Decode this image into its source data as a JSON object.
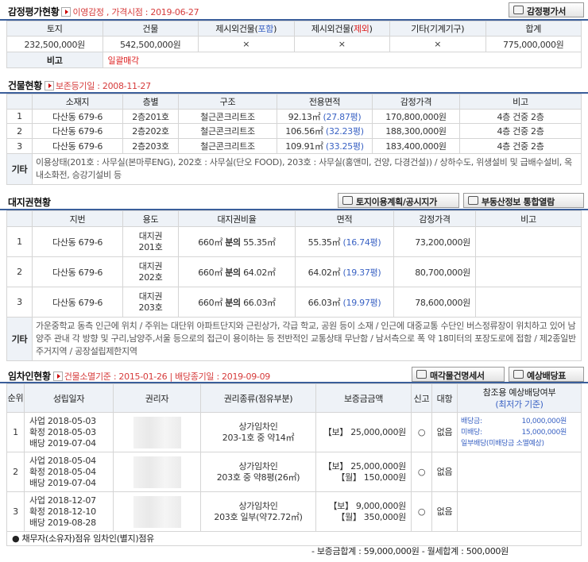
{
  "appraisal": {
    "title": "감정평가현황",
    "sub": "이영감정 , 가격시점 : 2019-06-27",
    "button": "감정평가서",
    "headers": [
      "토지",
      "건물",
      "제시외건물(포함)",
      "제시외건물(제외)",
      "기타(기계기구)",
      "합계"
    ],
    "h3a": "제시외건물(",
    "h3b": "포함",
    "h3c": ")",
    "h4a": "제시외건물(",
    "h4b": "제외",
    "h4c": ")",
    "values": [
      "232,500,000원",
      "542,500,000원",
      "×",
      "×",
      "×",
      "775,000,000원"
    ],
    "note_label": "비고",
    "note_value": "일괄매각"
  },
  "building": {
    "title": "건물현황",
    "sub": "보존등기일 : 2008-11-27",
    "headers": [
      "소재지",
      "층별",
      "구조",
      "전용면적",
      "감정가격",
      "비고"
    ],
    "rows": [
      {
        "no": "1",
        "loc": "다산동 679-6",
        "floor": "2층201호",
        "struct": "철근콘크리트조",
        "area": "92.13㎡",
        "pyeong": "(27.87평)",
        "price": "170,800,000원",
        "note": "4층 건중 2층"
      },
      {
        "no": "2",
        "loc": "다산동 679-6",
        "floor": "2층202호",
        "struct": "철근콘크리트조",
        "area": "106.56㎡",
        "pyeong": "(32.23평)",
        "price": "188,300,000원",
        "note": "4층 건중 2층"
      },
      {
        "no": "3",
        "loc": "다산동 679-6",
        "floor": "2층203호",
        "struct": "철근콘크리트조",
        "area": "109.91㎡",
        "pyeong": "(33.25평)",
        "price": "183,400,000원",
        "note": "4층 건중 2층"
      }
    ],
    "etc_label": "기타",
    "etc_text": "이용상태(201호 : 사무실(본마루ENG), 202호 : 사무실(단오 FOOD), 203호 : 사무실(홍앤미, 건양, 다경건설)) / 상하수도, 위생설비 및 급배수설비, 옥내소화전, 승강기설비 등"
  },
  "land": {
    "title": "대지권현황",
    "btn1": "토지이용계획/공시지가",
    "btn2": "부동산정보 통합열람",
    "headers": [
      "지번",
      "용도",
      "대지권비율",
      "면적",
      "감정가격",
      "비고"
    ],
    "rows": [
      {
        "no": "1",
        "lot": "다산동 679-6",
        "use1": "대지권",
        "use2": "201호",
        "ratio_a": "660㎡",
        "ratio_b": "분의",
        "ratio_c": "55.35㎡",
        "area": "55.35㎡",
        "pyeong": "(16.74평)",
        "price": "73,200,000원"
      },
      {
        "no": "2",
        "lot": "다산동 679-6",
        "use1": "대지권",
        "use2": "202호",
        "ratio_a": "660㎡",
        "ratio_b": "분의",
        "ratio_c": "64.02㎡",
        "area": "64.02㎡",
        "pyeong": "(19.37평)",
        "price": "80,700,000원"
      },
      {
        "no": "3",
        "lot": "다산동 679-6",
        "use1": "대지권",
        "use2": "203호",
        "ratio_a": "660㎡",
        "ratio_b": "분의",
        "ratio_c": "66.03㎡",
        "area": "66.03㎡",
        "pyeong": "(19.97평)",
        "price": "78,600,000원"
      }
    ],
    "etc_label": "기타",
    "etc_text": "가운중학교 동측 인근에 위치 / 주위는 대단위 아파트단지와 근린상가, 각급 학교, 공원 등이 소재 / 인근에 대중교통 수단인 버스정류장이 위치하고 있어 남양주 관내 각 방향 및 구리,남양주,서울 등으로의 접근이 용이하는 등 전반적인 교통상태 무난함 / 남서측으로 폭 약 18미터의 포장도로에 접함 / 제2종일반주거지역 / 공장설립제한지역"
  },
  "tenant": {
    "title": "임차인현황",
    "sub": "건물소멸기준 : 2015-01-26 | 배당종기일 : 2019-09-09",
    "btn1": "매각물건명세서",
    "btn2": "예상배당표",
    "h_no": "순위",
    "h_date": "성립일자",
    "h_holder": "권리자",
    "h_type": "권리종류(점유부분)",
    "h_amount": "보증금금액",
    "h_report": "신고",
    "h_claim": "대항",
    "h_div": "참조용 예상배당여부",
    "h_div_sub": "(최저가 기준)",
    "rows": [
      {
        "no": "1",
        "d1": "사업 2018-05-03",
        "d2": "확정 2018-05-03",
        "d3": "배당 2019-07-04",
        "type1": "상가임차인",
        "type2": "203-1호 중 약14㎡",
        "amt1": "【보】 25,000,000원",
        "amt2": "",
        "report": "○",
        "claim": "없음",
        "div1_l": "배당금:",
        "div1_v": "10,000,000원",
        "div2_l": "미배당:",
        "div2_v": "15,000,000원",
        "div3": "일부배당(미배당금 소멸예상)"
      },
      {
        "no": "2",
        "d1": "사업 2018-05-04",
        "d2": "확정 2018-05-04",
        "d3": "배당 2019-07-04",
        "type1": "상가임차인",
        "type2": "203호 중 약8평(26㎡)",
        "amt1": "【보】 25,000,000원",
        "amt2": "【월】 150,000원",
        "report": "○",
        "claim": "없음"
      },
      {
        "no": "3",
        "d1": "사업 2018-12-07",
        "d2": "확정 2018-12-10",
        "d3": "배당 2019-08-28",
        "type1": "상가임차인",
        "type2": "203호 일부(약72.72㎡)",
        "amt1": "【보】 9,000,000원",
        "amt2": "【월】 350,000원",
        "report": "○",
        "claim": "없음"
      }
    ],
    "footer": "● 채무자(소유자)점유 임차인(별지)점유",
    "total": "- 보증금합계 : 59,000,000원 - 월세합계 : 500,000원"
  },
  "colors": {
    "header_bg": "#eef2f7",
    "title_line": "#3a5e9a",
    "red": "#d63b3b",
    "blue": "#3b63c4"
  }
}
